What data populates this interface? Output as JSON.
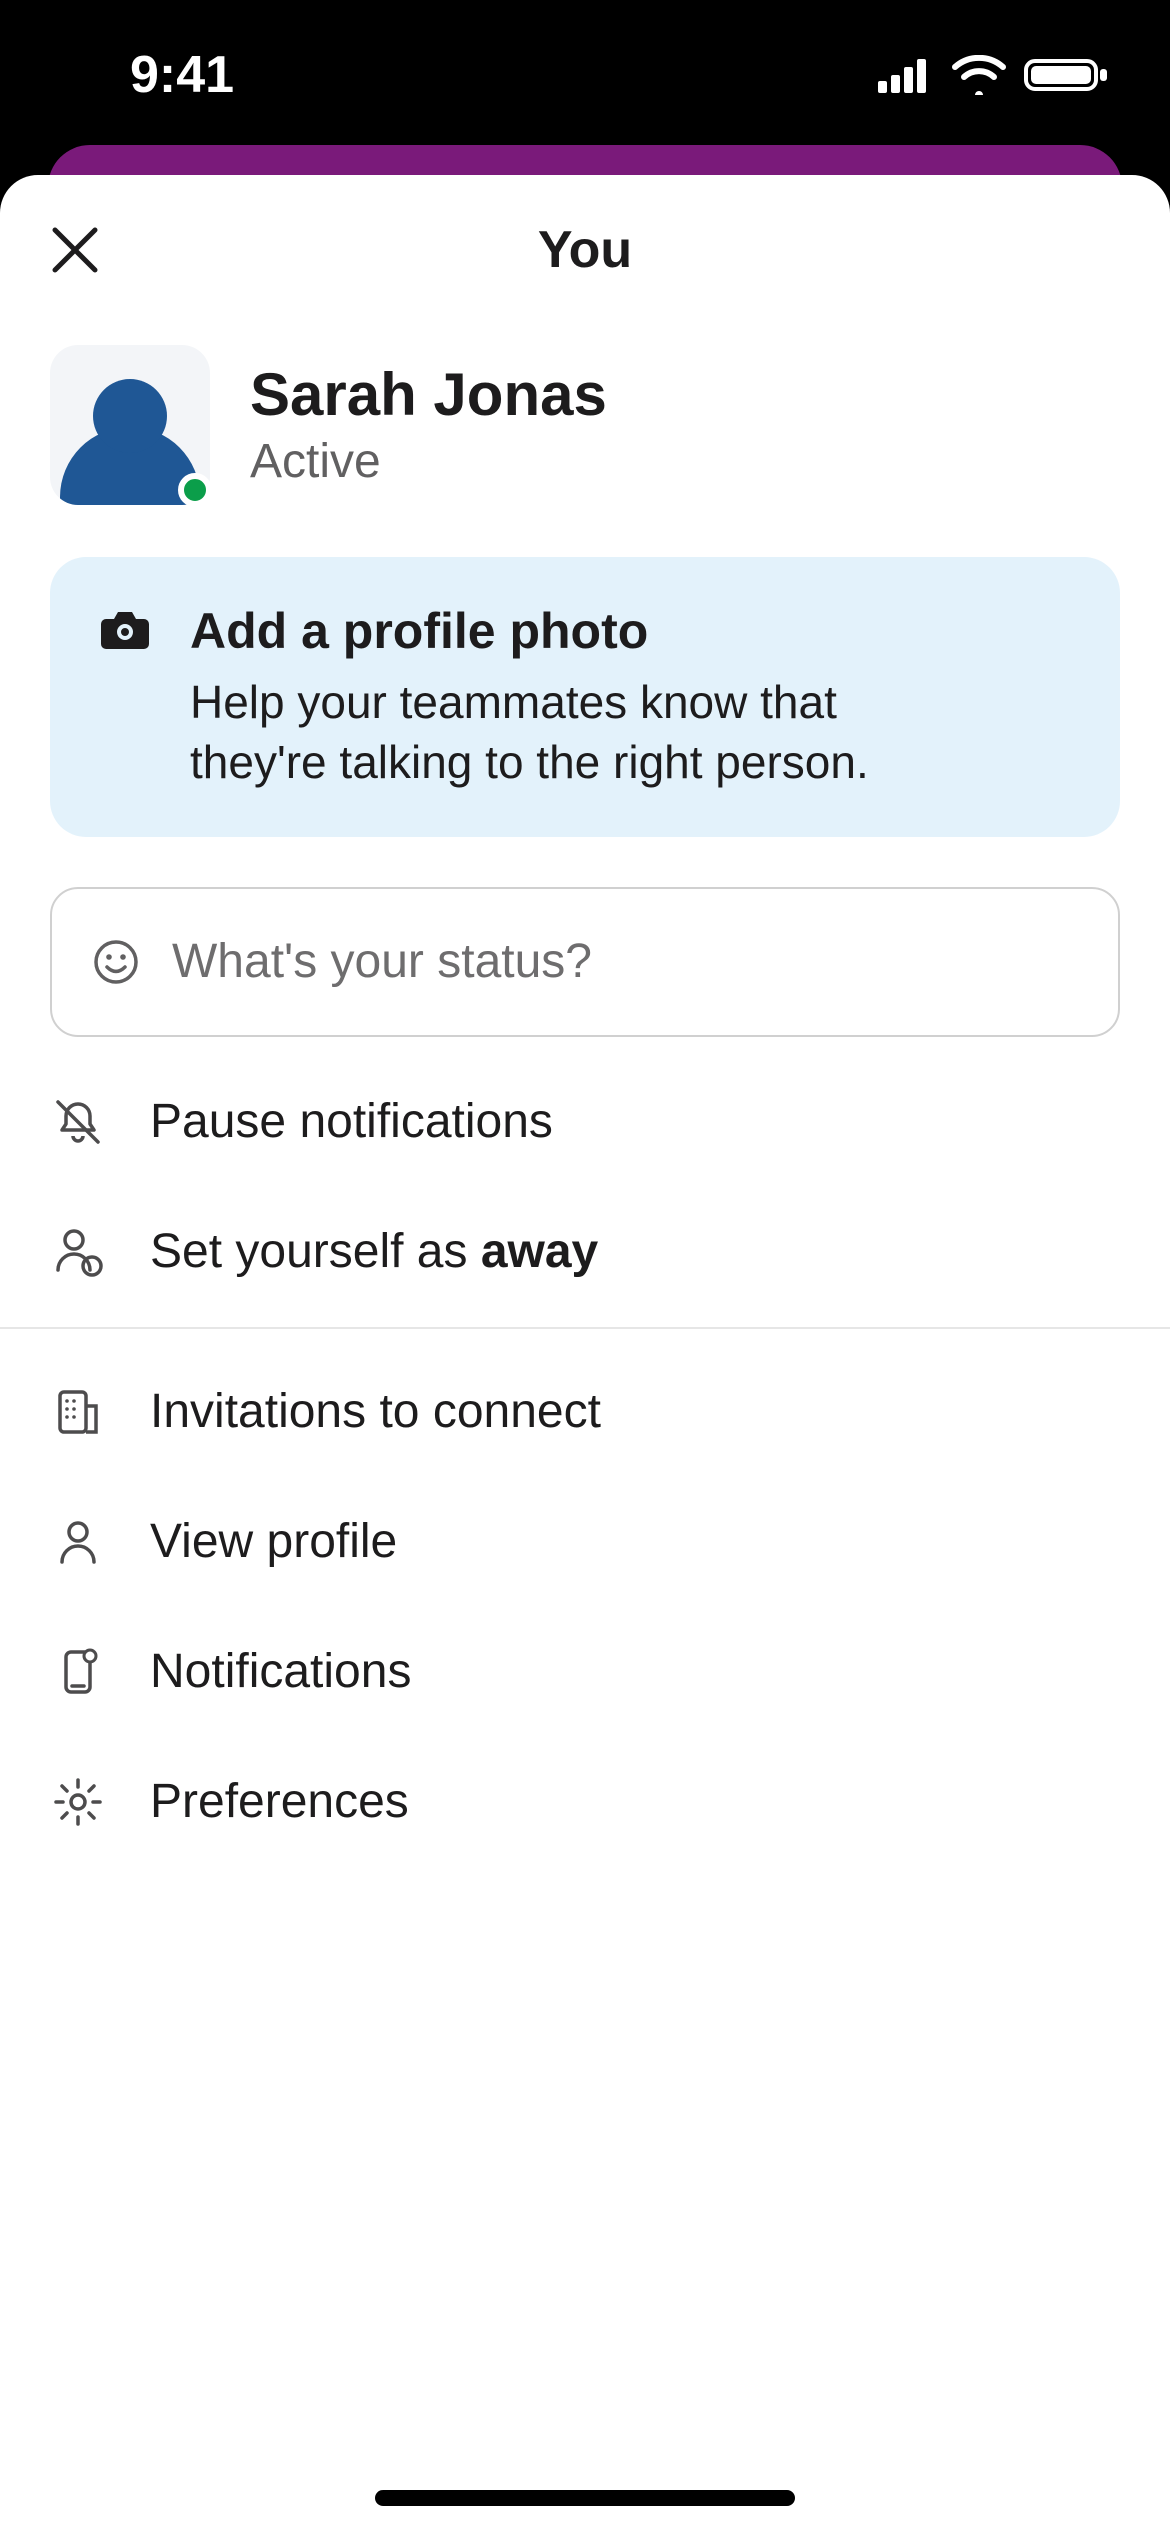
{
  "status_bar": {
    "time": "9:41"
  },
  "header": {
    "title": "You"
  },
  "profile": {
    "name": "Sarah Jonas",
    "presence": "Active"
  },
  "callout": {
    "title": "Add a profile photo",
    "description": "Help your teammates know that they're talking to the right person."
  },
  "status_input": {
    "placeholder": "What's your status?"
  },
  "menu": {
    "pause_notifications": "Pause notifications",
    "set_away_prefix": "Set yourself as ",
    "set_away_bold": "away",
    "invitations": "Invitations to connect",
    "view_profile": "View profile",
    "notifications": "Notifications",
    "preferences": "Preferences"
  }
}
